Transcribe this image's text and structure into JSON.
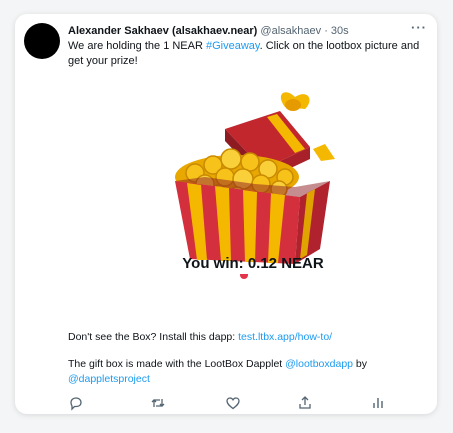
{
  "tweet": {
    "display_name": "Alexander Sakhaev (alsakhaev.near)",
    "handle": "@alsakhaev",
    "separator": "·",
    "time": "30s",
    "more": "···",
    "text_before": "We are holding the 1 NEAR ",
    "hashtag": "#Giveaway",
    "text_after": ". Click on the lootbox picture and get your prize!"
  },
  "media": {
    "win_text": "You win: 0.12 NEAR"
  },
  "install": {
    "text": "Don't see the Box? Install this dapp: ",
    "link": "test.ltbx.app/how-to/"
  },
  "credits": {
    "text1": "The gift box is made with the LootBox Dapplet ",
    "mention1": "@lootboxdapp",
    "text2": " by ",
    "mention2": "@dappletsproject"
  },
  "actions": {
    "icons": [
      "reply-icon",
      "retweet-icon",
      "like-icon",
      "share-icon",
      "analytics-icon"
    ],
    "color": "#536471"
  },
  "colors": {
    "link": "#1d9bf0",
    "box_red": "#d32f3c",
    "box_yellow": "#f5b800",
    "coin_gold": "#f7c21a"
  }
}
